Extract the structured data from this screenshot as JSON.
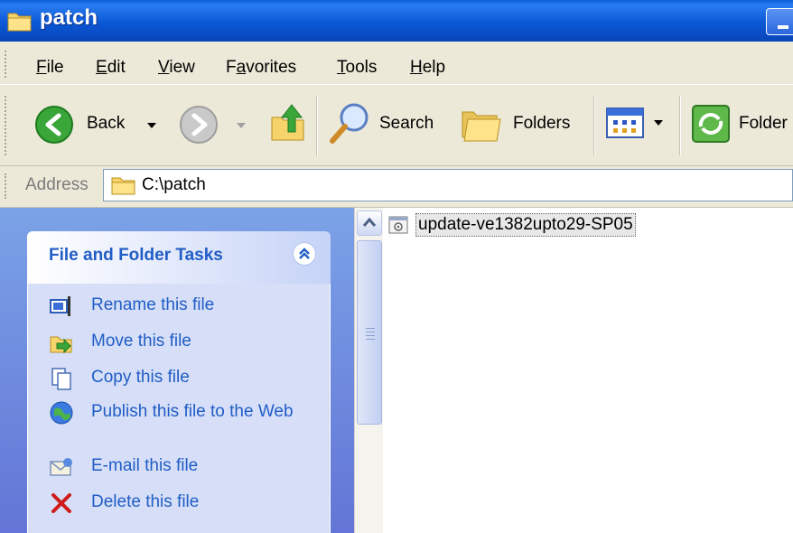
{
  "window": {
    "title": "patch"
  },
  "menu": {
    "items": [
      {
        "key": "F",
        "rest": "ile"
      },
      {
        "key": "E",
        "rest": "dit"
      },
      {
        "key": "V",
        "rest": "iew"
      },
      {
        "pre": "F",
        "key": "a",
        "rest": "vorites"
      },
      {
        "key": "T",
        "rest": "ools"
      },
      {
        "key": "H",
        "rest": "elp"
      }
    ]
  },
  "toolbar": {
    "back_label": "Back",
    "search_label": "Search",
    "folders_label": "Folders",
    "folder_sync_label": "Folder"
  },
  "address": {
    "label": "Address",
    "value": "C:\\patch"
  },
  "tasks": {
    "title": "File and Folder Tasks",
    "items": [
      {
        "label": "Rename this file",
        "icon": "rename-icon"
      },
      {
        "label": "Move this file",
        "icon": "move-icon"
      },
      {
        "label": "Copy this file",
        "icon": "copy-icon"
      },
      {
        "label": "Publish this file to the Web",
        "icon": "publish-web-icon"
      },
      {
        "label": "E-mail this file",
        "icon": "email-icon"
      },
      {
        "label": "Delete this file",
        "icon": "delete-icon"
      }
    ]
  },
  "files": [
    {
      "name": "update-ve1382upto29-SP05",
      "icon": "batch-file-icon"
    }
  ],
  "colors": {
    "titlebar": "#0b58d6",
    "task_text": "#215dc6",
    "chrome": "#ece9d8"
  }
}
